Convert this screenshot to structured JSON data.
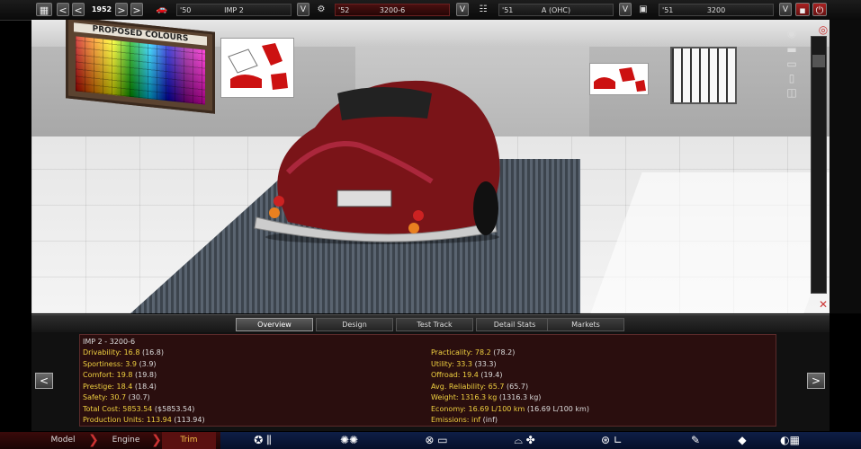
{
  "topbar": {
    "year": "1952",
    "car": {
      "year": "'50",
      "name": "IMP 2"
    },
    "engine": {
      "year": "'52",
      "name": "3200-6"
    },
    "chassis": {
      "year": "'51",
      "name": "A (OHC)"
    },
    "trim": {
      "year": "'51",
      "name": "3200"
    },
    "prev_label": "<",
    "next_label": ">",
    "dropdown_label": "V"
  },
  "tabs": [
    "Overview",
    "Design",
    "Test Track",
    "Detail Stats",
    "Markets"
  ],
  "active_tab": "Overview",
  "scene": {
    "poster_title": "PROPOSED COLOURS"
  },
  "stats": {
    "title": "IMP 2 - 3200-6",
    "left": [
      {
        "label": "Drivability:",
        "value": "16.8",
        "extra": "(16.8)"
      },
      {
        "label": "Sportiness:",
        "value": "3.9",
        "extra": "(3.9)"
      },
      {
        "label": "Comfort:",
        "value": "19.8",
        "extra": "(19.8)"
      },
      {
        "label": "Prestige:",
        "value": "18.4",
        "extra": "(18.4)"
      },
      {
        "label": "Safety:",
        "value": "30.7",
        "extra": "(30.7)"
      },
      {
        "label": "Total Cost:",
        "value": "5853.54",
        "extra": "($5853.54)"
      },
      {
        "label": "Production Units:",
        "value": "113.94",
        "extra": "(113.94)"
      }
    ],
    "right": [
      {
        "label": "Practicality:",
        "value": "78.2",
        "extra": "(78.2)"
      },
      {
        "label": "Utility:",
        "value": "33.3",
        "extra": "(33.3)"
      },
      {
        "label": "Offroad:",
        "value": "19.4",
        "extra": "(19.4)"
      },
      {
        "label": "Avg. Reliability:",
        "value": "65.7",
        "extra": "(65.7)"
      },
      {
        "label": "Weight:",
        "value": "1316.3 kg",
        "extra": "(1316.3 kg)"
      },
      {
        "label": "Economy:",
        "value": "16.69 L/100 km",
        "extra": "(16.69 L/100 km)"
      },
      {
        "label": "Emissions:",
        "value": "inf",
        "extra": "(inf)"
      }
    ]
  },
  "bottombar": {
    "model": "Model",
    "engine": "Engine",
    "trim": "Trim"
  },
  "nav": {
    "left": "<",
    "right": ">"
  },
  "colors": {
    "accent_gold": "#f0d040",
    "car_body": "#7a1418",
    "bottombar_red": "#3a0a0a"
  }
}
